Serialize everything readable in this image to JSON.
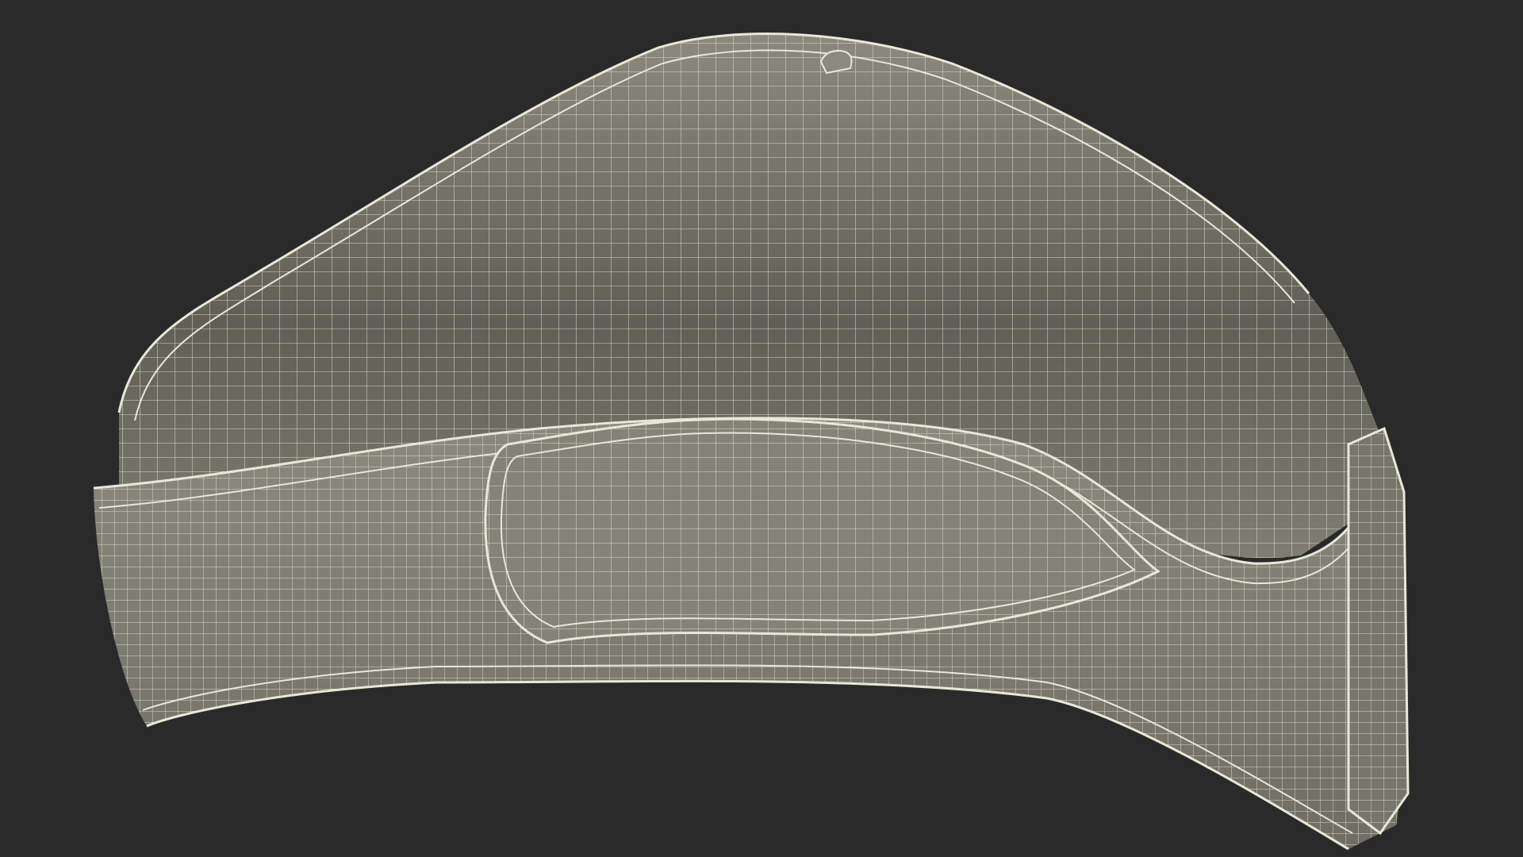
{
  "scene": {
    "background_color": "#2a2a2a",
    "mesh_fill_color": "#7e7e72",
    "mesh_shadow_color": "#5f5f55",
    "mesh_highlight_color": "#8a8a7e",
    "wire_color": "#e8e8d8",
    "subject_icon": "wireframe-3d-model-icon"
  }
}
